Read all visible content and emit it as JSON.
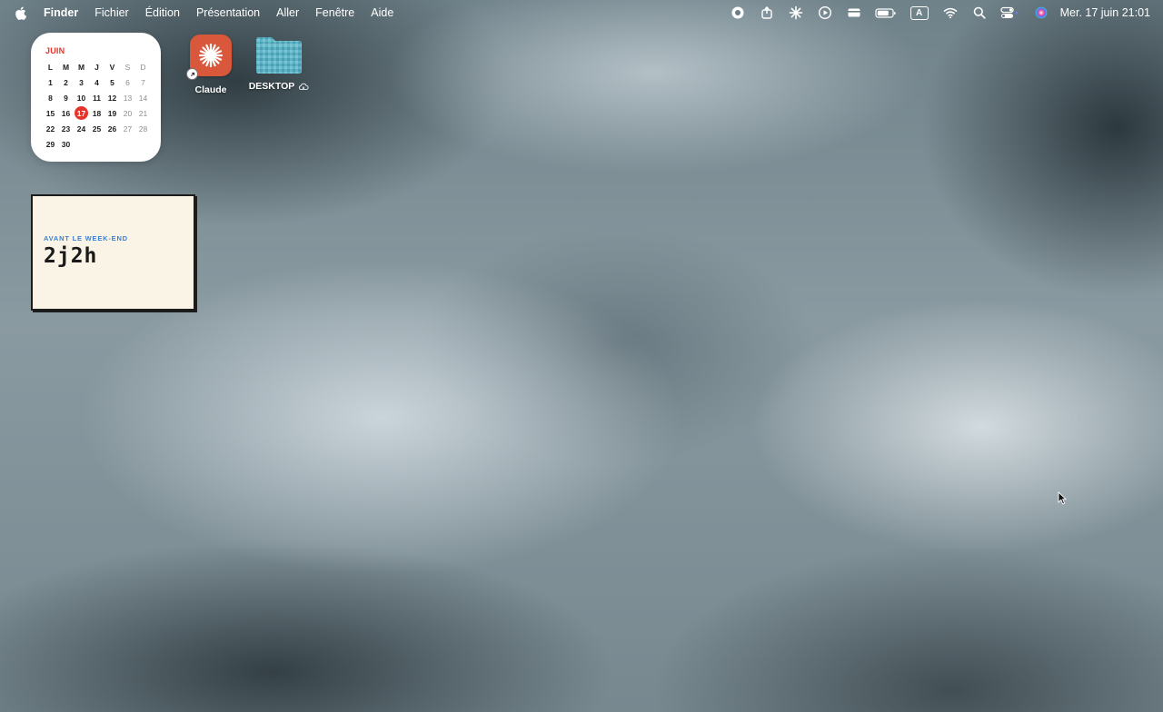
{
  "menubar": {
    "app_name": "Finder",
    "items": [
      {
        "label": "Fichier"
      },
      {
        "label": "Édition"
      },
      {
        "label": "Présentation"
      },
      {
        "label": "Aller"
      },
      {
        "label": "Fenêtre"
      },
      {
        "label": "Aide"
      }
    ],
    "status_icons": [
      "record-icon",
      "share-icon",
      "claude-burst-icon",
      "play-icon",
      "card-icon",
      "battery-icon",
      "input-source-icon",
      "wifi-icon",
      "spotlight-search-icon",
      "control-center-icon",
      "siri-icon"
    ],
    "input_source_letter": "A",
    "clock": "Mer. 17 juin  21:01"
  },
  "calendar_widget": {
    "month": "JUIN",
    "weekdays": [
      "L",
      "M",
      "M",
      "J",
      "V",
      "S",
      "D"
    ],
    "weeks": [
      [
        "1",
        "2",
        "3",
        "4",
        "5",
        "6",
        "7"
      ],
      [
        "8",
        "9",
        "10",
        "11",
        "12",
        "13",
        "14"
      ],
      [
        "15",
        "16",
        "17",
        "18",
        "19",
        "20",
        "21"
      ],
      [
        "22",
        "23",
        "24",
        "25",
        "26",
        "27",
        "28"
      ],
      [
        "29",
        "30",
        "",
        "",
        "",
        "",
        ""
      ]
    ],
    "today": "17",
    "accent_color": "#e5352b"
  },
  "desktop_icons": [
    {
      "label": "Claude",
      "icon": "claude-app-icon",
      "color": "#d9573a"
    },
    {
      "label": "DESKTOP",
      "icon": "folder-icon",
      "color": "#5fb3c4"
    }
  ],
  "countdown_widget": {
    "label": "AVANT LE WEEK-END",
    "value": "2j2h",
    "label_color": "#3b7fd0"
  }
}
